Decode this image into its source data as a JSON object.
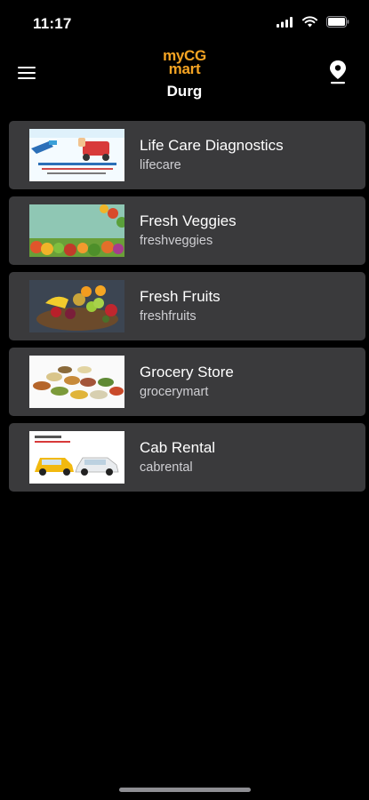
{
  "status_bar": {
    "time": "11:17"
  },
  "header": {
    "logo_line1": "myCG",
    "logo_line2": "mart",
    "city": "Durg",
    "accent_color": "#f5a423",
    "menu_icon": "hamburger-menu-icon",
    "location_icon": "location-pin-icon"
  },
  "stores": [
    {
      "name": "Life Care Diagnostics",
      "slug": "lifecare"
    },
    {
      "name": "Fresh Veggies",
      "slug": "freshveggies"
    },
    {
      "name": "Fresh Fruits",
      "slug": "freshfruits"
    },
    {
      "name": "Grocery Store",
      "slug": "grocerymart"
    },
    {
      "name": "Cab Rental",
      "slug": "cabrental"
    }
  ]
}
